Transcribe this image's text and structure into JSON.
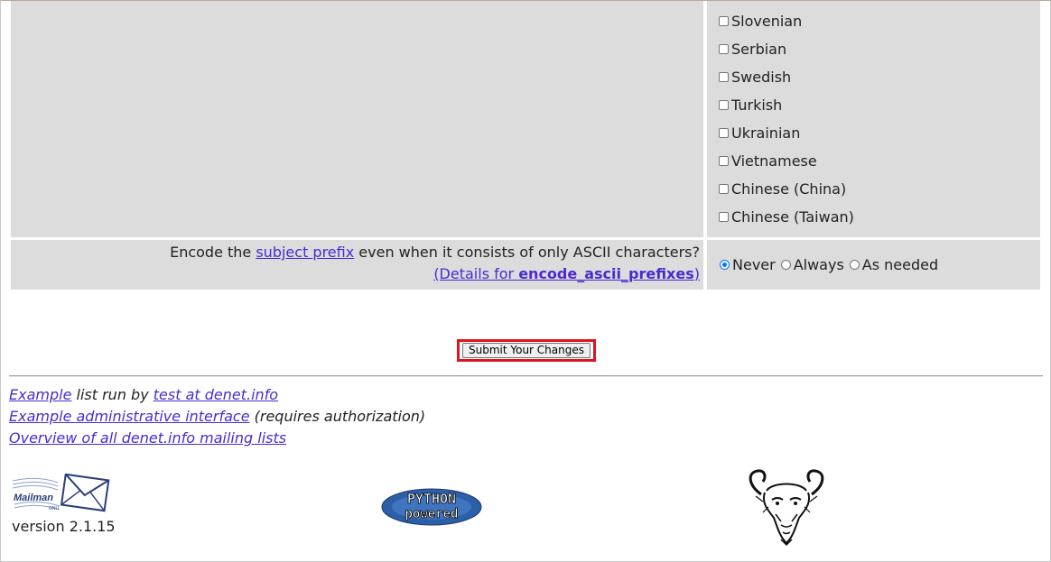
{
  "languages": [
    {
      "label": "Slovenian",
      "checked": false
    },
    {
      "label": "Serbian",
      "checked": false
    },
    {
      "label": "Swedish",
      "checked": false
    },
    {
      "label": "Turkish",
      "checked": false
    },
    {
      "label": "Ukrainian",
      "checked": false
    },
    {
      "label": "Vietnamese",
      "checked": false
    },
    {
      "label": "Chinese (China)",
      "checked": false
    },
    {
      "label": "Chinese (Taiwan)",
      "checked": false
    }
  ],
  "encode": {
    "question_before": "Encode the ",
    "question_link": "subject prefix",
    "question_after": " even when it consists of only ASCII characters?",
    "details_prefix": "(Details for ",
    "details_bold": "encode_ascii_prefixes",
    "details_suffix": ")",
    "options": [
      {
        "label": "Never",
        "checked": true
      },
      {
        "label": "Always",
        "checked": false
      },
      {
        "label": "As needed",
        "checked": false
      }
    ]
  },
  "submit": {
    "label": "Submit Your Changes"
  },
  "footer": {
    "list_name_link": "Example",
    "run_by_text": " list run by ",
    "owner_link": "test at denet.info",
    "admin_link": "Example administrative interface",
    "admin_note": " (requires authorization)",
    "overview_link": "Overview of all denet.info mailing lists",
    "version": "version 2.1.15"
  },
  "logos": {
    "mailman_text": "Mailman",
    "mailman_sub": "GNU",
    "python_top": "PYTHON",
    "python_bottom": "powered"
  },
  "colors": {
    "cell_bg": "#dcdcdc",
    "link": "#4a2bd0",
    "highlight": "#e0141e",
    "radio_checked": "#0075ff"
  }
}
